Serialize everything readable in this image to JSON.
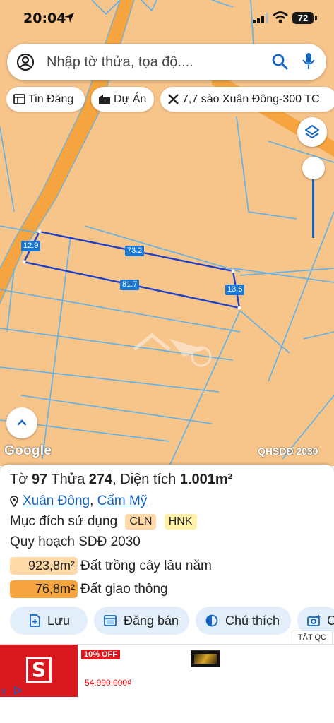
{
  "status_bar": {
    "time": "20:04",
    "battery": "72"
  },
  "search": {
    "placeholder": "Nhập tờ thửa, tọa độ...."
  },
  "chips": [
    {
      "label": "Tin Đăng",
      "icon": "news-list-icon"
    },
    {
      "label": "Dự Án",
      "icon": "buildings-icon"
    },
    {
      "label": "7,7 sào Xuân Đông-300 TC",
      "icon": "ruler-tools-icon"
    }
  ],
  "map": {
    "dimensions": [
      "12.9",
      "73.2",
      "81.7",
      "13.6"
    ],
    "google_logo": "Google",
    "overlay_label": "QHSDĐ 2030",
    "colors": {
      "land": "#f7c48a",
      "road": "#f5a43f",
      "parcel_lines": "#5fb2e8",
      "selected_parcel": "#1e40c8"
    }
  },
  "parcel": {
    "to_label": "Tờ",
    "to_value": "97",
    "thua_label": "Thửa",
    "thua_value": "274",
    "area_label": "Diện tích",
    "area_value": "1.001m²",
    "commune": "Xuân Đông",
    "district": "Cẩm Mỹ",
    "purpose_label": "Mục đích sử dụng",
    "purpose_tags": [
      "CLN",
      "HNK"
    ],
    "plan_label": "Quy hoạch SDĐ 2030",
    "land_uses": [
      {
        "area": "923,8m²",
        "desc": "Đất trồng cây lâu năm",
        "color": "#ffd9a8"
      },
      {
        "area": "76,8m²",
        "desc": "Đất giao thông",
        "color": "#f5a43f"
      }
    ]
  },
  "actions": [
    {
      "label": "Lưu",
      "icon": "save-plus-icon"
    },
    {
      "label": "Đăng bán",
      "icon": "listing-icon"
    },
    {
      "label": "Chú thích",
      "icon": "legend-half-circle-icon"
    },
    {
      "label": "C",
      "icon": "camera-icon"
    }
  ],
  "ad": {
    "close_label": "TẮT QC",
    "discount": "10% OFF",
    "old_price": "54.990.000₫",
    "brand_letter": "S",
    "close_x": "x"
  }
}
